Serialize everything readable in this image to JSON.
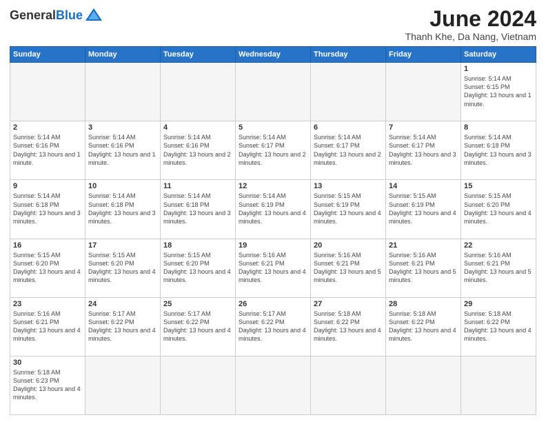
{
  "header": {
    "logo_general": "General",
    "logo_blue": "Blue",
    "title": "June 2024",
    "subtitle": "Thanh Khe, Da Nang, Vietnam"
  },
  "weekdays": [
    "Sunday",
    "Monday",
    "Tuesday",
    "Wednesday",
    "Thursday",
    "Friday",
    "Saturday"
  ],
  "days": {
    "d1": {
      "num": "1",
      "sr": "5:14 AM",
      "ss": "6:15 PM",
      "dl": "13 hours and 1 minute."
    },
    "d2": {
      "num": "2",
      "sr": "5:14 AM",
      "ss": "6:16 PM",
      "dl": "13 hours and 1 minute."
    },
    "d3": {
      "num": "3",
      "sr": "5:14 AM",
      "ss": "6:16 PM",
      "dl": "13 hours and 1 minute."
    },
    "d4": {
      "num": "4",
      "sr": "5:14 AM",
      "ss": "6:16 PM",
      "dl": "13 hours and 2 minutes."
    },
    "d5": {
      "num": "5",
      "sr": "5:14 AM",
      "ss": "6:17 PM",
      "dl": "13 hours and 2 minutes."
    },
    "d6": {
      "num": "6",
      "sr": "5:14 AM",
      "ss": "6:17 PM",
      "dl": "13 hours and 2 minutes."
    },
    "d7": {
      "num": "7",
      "sr": "5:14 AM",
      "ss": "6:17 PM",
      "dl": "13 hours and 3 minutes."
    },
    "d8": {
      "num": "8",
      "sr": "5:14 AM",
      "ss": "6:18 PM",
      "dl": "13 hours and 3 minutes."
    },
    "d9": {
      "num": "9",
      "sr": "5:14 AM",
      "ss": "6:18 PM",
      "dl": "13 hours and 3 minutes."
    },
    "d10": {
      "num": "10",
      "sr": "5:14 AM",
      "ss": "6:18 PM",
      "dl": "13 hours and 3 minutes."
    },
    "d11": {
      "num": "11",
      "sr": "5:14 AM",
      "ss": "6:18 PM",
      "dl": "13 hours and 3 minutes."
    },
    "d12": {
      "num": "12",
      "sr": "5:14 AM",
      "ss": "6:19 PM",
      "dl": "13 hours and 4 minutes."
    },
    "d13": {
      "num": "13",
      "sr": "5:15 AM",
      "ss": "6:19 PM",
      "dl": "13 hours and 4 minutes."
    },
    "d14": {
      "num": "14",
      "sr": "5:15 AM",
      "ss": "6:19 PM",
      "dl": "13 hours and 4 minutes."
    },
    "d15": {
      "num": "15",
      "sr": "5:15 AM",
      "ss": "6:20 PM",
      "dl": "13 hours and 4 minutes."
    },
    "d16": {
      "num": "16",
      "sr": "5:15 AM",
      "ss": "6:20 PM",
      "dl": "13 hours and 4 minutes."
    },
    "d17": {
      "num": "17",
      "sr": "5:15 AM",
      "ss": "6:20 PM",
      "dl": "13 hours and 4 minutes."
    },
    "d18": {
      "num": "18",
      "sr": "5:15 AM",
      "ss": "6:20 PM",
      "dl": "13 hours and 4 minutes."
    },
    "d19": {
      "num": "19",
      "sr": "5:16 AM",
      "ss": "6:21 PM",
      "dl": "13 hours and 4 minutes."
    },
    "d20": {
      "num": "20",
      "sr": "5:16 AM",
      "ss": "6:21 PM",
      "dl": "13 hours and 5 minutes."
    },
    "d21": {
      "num": "21",
      "sr": "5:16 AM",
      "ss": "6:21 PM",
      "dl": "13 hours and 5 minutes."
    },
    "d22": {
      "num": "22",
      "sr": "5:16 AM",
      "ss": "6:21 PM",
      "dl": "13 hours and 5 minutes."
    },
    "d23": {
      "num": "23",
      "sr": "5:16 AM",
      "ss": "6:21 PM",
      "dl": "13 hours and 4 minutes."
    },
    "d24": {
      "num": "24",
      "sr": "5:17 AM",
      "ss": "6:22 PM",
      "dl": "13 hours and 4 minutes."
    },
    "d25": {
      "num": "25",
      "sr": "5:17 AM",
      "ss": "6:22 PM",
      "dl": "13 hours and 4 minutes."
    },
    "d26": {
      "num": "26",
      "sr": "5:17 AM",
      "ss": "6:22 PM",
      "dl": "13 hours and 4 minutes."
    },
    "d27": {
      "num": "27",
      "sr": "5:18 AM",
      "ss": "6:22 PM",
      "dl": "13 hours and 4 minutes."
    },
    "d28": {
      "num": "28",
      "sr": "5:18 AM",
      "ss": "6:22 PM",
      "dl": "13 hours and 4 minutes."
    },
    "d29": {
      "num": "29",
      "sr": "5:18 AM",
      "ss": "6:22 PM",
      "dl": "13 hours and 4 minutes."
    },
    "d30": {
      "num": "30",
      "sr": "5:18 AM",
      "ss": "6:23 PM",
      "dl": "13 hours and 4 minutes."
    }
  }
}
